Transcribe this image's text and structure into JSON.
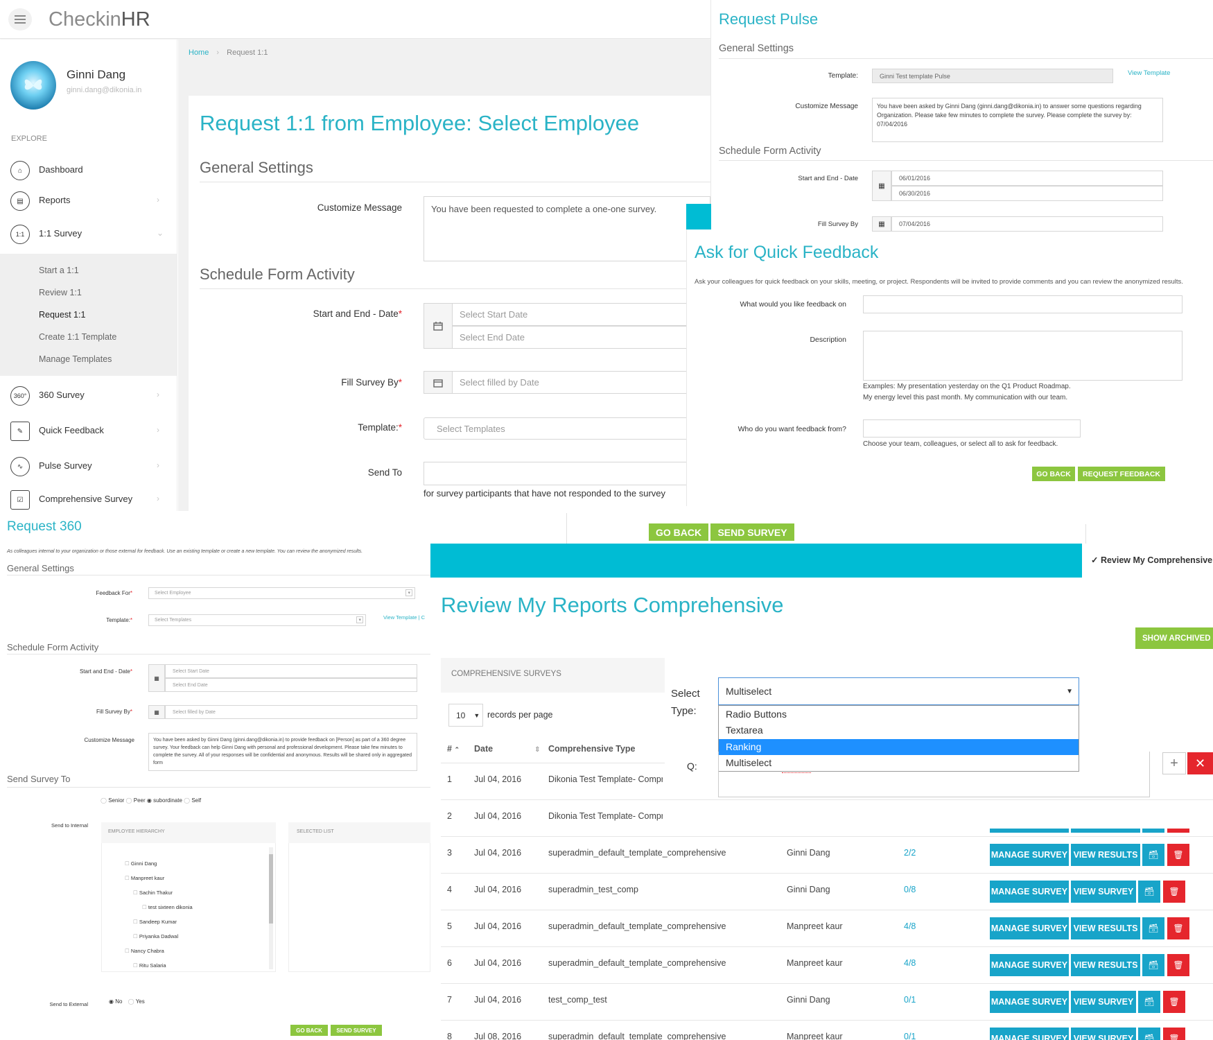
{
  "app": {
    "logo_left": "Checkin",
    "logo_right": "HR"
  },
  "user": {
    "name": "Ginni Dang",
    "email": "ginni.dang@dikonia.in"
  },
  "sidebar": {
    "explore_label": "EXPLORE",
    "items": [
      {
        "label": "Dashboard"
      },
      {
        "label": "Reports"
      },
      {
        "label": "1:1 Survey"
      },
      {
        "label": "360 Survey"
      },
      {
        "label": "Quick Feedback"
      },
      {
        "label": "Pulse Survey"
      },
      {
        "label": "Comprehensive Survey"
      }
    ],
    "sub_items": [
      {
        "label": "Start a 1:1"
      },
      {
        "label": "Review 1:1"
      },
      {
        "label": "Request 1:1"
      },
      {
        "label": "Create 1:1 Template"
      },
      {
        "label": "Manage Templates"
      }
    ]
  },
  "breadcrumb": {
    "home": "Home",
    "current": "Request 1:1"
  },
  "request11": {
    "title": "Request 1:1 from Employee: Select Employee",
    "general_settings": "General Settings",
    "customize_label": "Customize Message",
    "customize_value": "You have been requested to complete a one-one survey.",
    "schedule": "Schedule Form Activity",
    "date_label": "Start and End - Date",
    "start_placeholder": "Select Start Date",
    "end_placeholder": "Select End Date",
    "fill_label": "Fill Survey By",
    "fill_placeholder": "Select filled by Date",
    "template_label": "Template:",
    "template_placeholder": "Select Templates",
    "send_to_label": "Send To",
    "send_to_note": "for survey participants that have not responded to the survey",
    "go_back": "GO BACK",
    "send_survey": "SEND SURVEY"
  },
  "pulse": {
    "title": "Request Pulse",
    "general_settings": "General Settings",
    "template_label": "Template:",
    "template_value": "Ginni Test template Pulse",
    "view_template": "View Template",
    "customize_label": "Customize Message",
    "customize_value": "You have been asked by Ginni Dang (ginni.dang@dikonia.in) to answer some questions regarding Organization. Please take few minutes to complete the survey. Please complete the survey by: 07/04/2016",
    "schedule": "Schedule Form Activity",
    "date_label": "Start and End - Date",
    "start_value": "06/01/2016",
    "end_value": "06/30/2016",
    "fill_label": "Fill Survey By",
    "fill_value": "07/04/2016"
  },
  "quick": {
    "title": "Ask for Quick Feedback",
    "intro": "Ask your colleagues for quick feedback on your skills, meeting, or project. Respondents will be invited to provide comments and you can review the anonymized results.",
    "what_label": "What would you like feedback on",
    "desc_label": "Description",
    "examples_1": "Examples: My presentation yesterday on the Q1 Product Roadmap.",
    "examples_2": "My energy level this past month. My communication with our team.",
    "who_label": "Who do you want feedback from?",
    "who_hint": "Choose your team, colleagues, or select all to ask for feedback.",
    "go_back": "GO BACK",
    "request": "REQUEST FEEDBACK"
  },
  "r360": {
    "title": "Request 360",
    "intro": "As colleagues internal to your organization or those external for feedback. Use an existing template or create a new template. You can review the anonymized results.",
    "general_settings": "General Settings",
    "feedback_for_label": "Feedback For",
    "feedback_for_placeholder": "Select Employee",
    "template_label": "Template:",
    "template_placeholder": "Select Templates",
    "view_template": "View Template | C",
    "schedule": "Schedule Form Activity",
    "date_label": "Start and End - Date",
    "start_placeholder": "Select Start Date",
    "end_placeholder": "Select End Date",
    "fill_label": "Fill Survey By",
    "fill_placeholder": "Select filled by Date",
    "customize_label": "Customize Message",
    "customize_value": "You have been asked by Ginni Dang (ginni.dang@dikonia.in) to provide feedback on [Person] as part of a 360 degree survey. Your feedback can help Ginni Dang with personal and professional development. Please take few minutes to complete the survey. All of your responses will be confidential and anonymous. Results will be shared only in aggregated form",
    "send_to": "Send Survey To",
    "radios": [
      "Senior",
      "Peer",
      "subordinate",
      "Self"
    ],
    "send_internal": "Send to Internal",
    "hierarchy_header": "EMPLOYEE HIERARCHY",
    "selected_header": "SELECTED LIST",
    "tree": [
      "Ginni Dang",
      "Manpreet kaur",
      "Sachin Thakur",
      "test sixteen dikonia",
      "Sandeep Kumar",
      "Priyanka Dadwal",
      "Nancy Chabra",
      "Ritu Salaria"
    ],
    "send_external": "Send to External",
    "no": "No",
    "yes": "Yes",
    "go_back": "GO BACK",
    "send_survey": "SEND SURVEY"
  },
  "review": {
    "title": "Review My Reports Comprehensive",
    "top_tab": "Review My Comprehensive S",
    "show_archived": "SHOW ARCHIVED R",
    "panel_title": "COMPREHENSIVE SURVEYS",
    "records_value": "10",
    "records_label": "records per page",
    "columns": [
      "#",
      "Date",
      "Comprehensive Type"
    ],
    "rows": [
      {
        "n": "1",
        "date": "Jul 04, 2016",
        "type": "Dikonia Test Template- Compre",
        "owner": "",
        "count": "",
        "b1": "",
        "b2": ""
      },
      {
        "n": "2",
        "date": "Jul 04, 2016",
        "type": "Dikonia Test Template- Compre",
        "owner": "",
        "count": "",
        "b1": "",
        "b2": ""
      },
      {
        "n": "3",
        "date": "Jul 04, 2016",
        "type": "superadmin_default_template_comprehensive",
        "owner": "Ginni Dang",
        "count": "2/2",
        "b1": "MANAGE SURVEY",
        "b2": "VIEW RESULTS"
      },
      {
        "n": "4",
        "date": "Jul 04, 2016",
        "type": "superadmin_test_comp",
        "owner": "Ginni Dang",
        "count": "0/8",
        "b1": "MANAGE SURVEY",
        "b2": "VIEW SURVEY"
      },
      {
        "n": "5",
        "date": "Jul 04, 2016",
        "type": "superadmin_default_template_comprehensive",
        "owner": "Manpreet kaur",
        "count": "4/8",
        "b1": "MANAGE SURVEY",
        "b2": "VIEW RESULTS"
      },
      {
        "n": "6",
        "date": "Jul 04, 2016",
        "type": "superadmin_default_template_comprehensive",
        "owner": "Manpreet kaur",
        "count": "4/8",
        "b1": "MANAGE SURVEY",
        "b2": "VIEW RESULTS"
      },
      {
        "n": "7",
        "date": "Jul 04, 2016",
        "type": "test_comp_test",
        "owner": "Ginni Dang",
        "count": "0/1",
        "b1": "MANAGE SURVEY",
        "b2": "VIEW SURVEY"
      },
      {
        "n": "8",
        "date": "Jul 08, 2016",
        "type": "superadmin_default_template_comprehensive",
        "owner": "Manpreet kaur",
        "count": "0/1",
        "b1": "MANAGE SURVEY",
        "b2": "VIEW SURVEY"
      }
    ]
  },
  "type_popup": {
    "select_label_1": "Select",
    "select_label_2": "Type:",
    "selected": "Multiselect",
    "options": [
      "Radio Buttons",
      "Textarea",
      "Ranking",
      "Multiselect"
    ],
    "highlighted": "Ranking",
    "q_label": "Q:"
  },
  "colors": {
    "accent": "#2ab3c6",
    "green": "#8cc63f",
    "blue_btn": "#18a4c9",
    "danger": "#e5262d",
    "cyan_bar": "#00bcd4",
    "highlight": "#1e90ff"
  }
}
